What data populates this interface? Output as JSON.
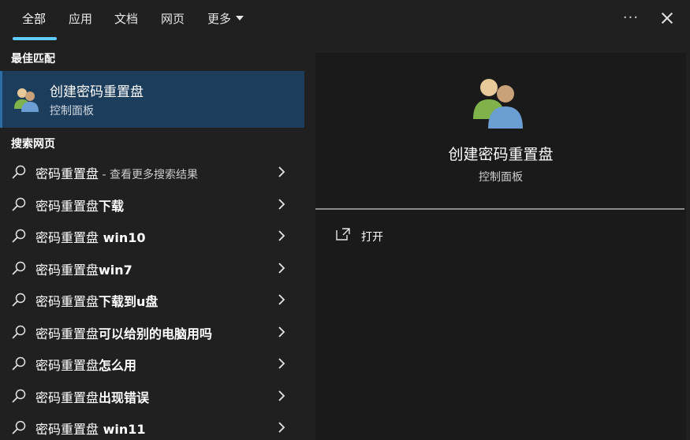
{
  "tabs": [
    {
      "label": "全部",
      "active": true
    },
    {
      "label": "应用"
    },
    {
      "label": "文档"
    },
    {
      "label": "网页"
    },
    {
      "label": "更多"
    }
  ],
  "toolbar": {
    "more_options": "···"
  },
  "best_match": {
    "header": "最佳匹配",
    "title": "创建密码重置盘",
    "subtitle": "控制面板",
    "icon": "user-accounts-icon"
  },
  "web_search": {
    "header": "搜索网页",
    "items": [
      {
        "query": "密码重置盘",
        "suffix": "",
        "hint": " - 查看更多搜索结果"
      },
      {
        "query": "密码重置盘",
        "suffix": "下载",
        "hint": ""
      },
      {
        "query": "密码重置盘",
        "suffix": " win10",
        "hint": ""
      },
      {
        "query": "密码重置盘",
        "suffix": "win7",
        "hint": ""
      },
      {
        "query": "密码重置盘",
        "suffix": "下载到u盘",
        "hint": ""
      },
      {
        "query": "密码重置盘",
        "suffix": "可以给别的电脑用吗",
        "hint": ""
      },
      {
        "query": "密码重置盘",
        "suffix": "怎么用",
        "hint": ""
      },
      {
        "query": "密码重置盘",
        "suffix": "出现错误",
        "hint": ""
      },
      {
        "query": "密码重置盘",
        "suffix": " win11",
        "hint": ""
      }
    ]
  },
  "detail": {
    "title": "创建密码重置盘",
    "subtitle": "控制面板",
    "actions": [
      {
        "label": "打开",
        "icon": "open-external-icon"
      }
    ]
  },
  "colors": {
    "accent": "#60cdff",
    "selected_bg": "#1d3d5c",
    "background": "#202020",
    "detail_bg": "#1a1a1a"
  }
}
